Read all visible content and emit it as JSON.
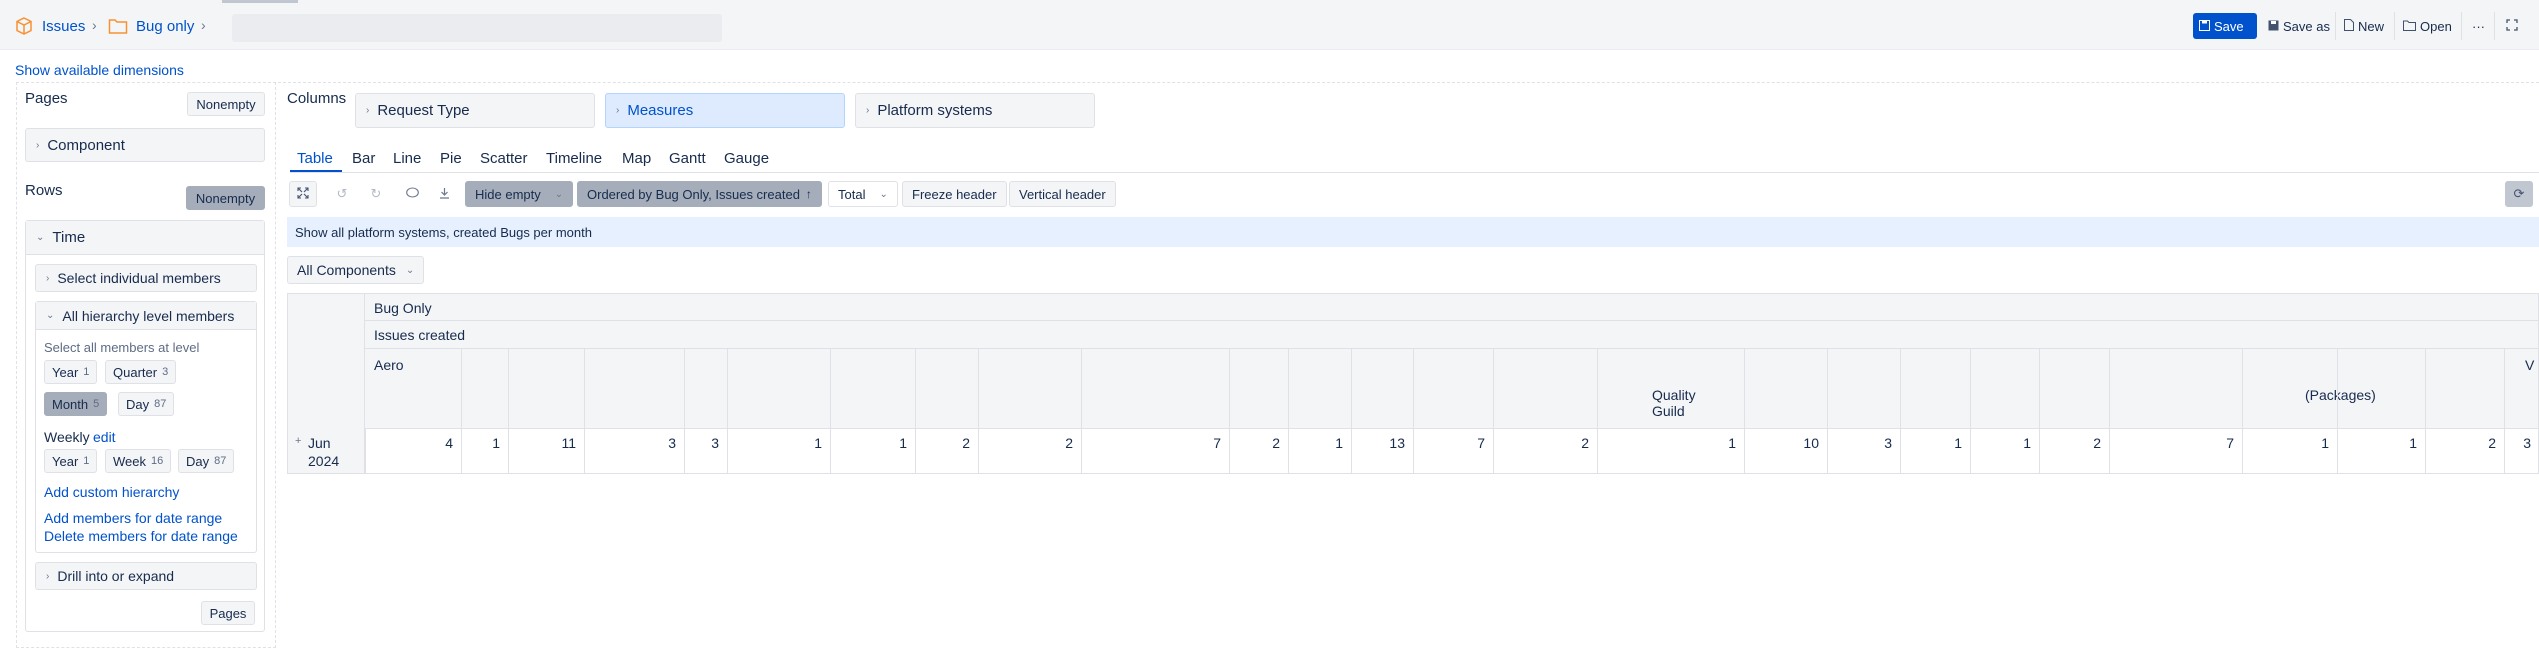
{
  "breadcrumb": {
    "issues": "Issues",
    "report": "Bug only"
  },
  "toolbar": {
    "save": "Save",
    "save_as": "Save as",
    "new": "New",
    "open": "Open",
    "more": "···"
  },
  "show_dimensions": "Show available dimensions",
  "pages": {
    "label": "Pages",
    "nonempty": "Nonempty",
    "dimension": "Component"
  },
  "columns": {
    "label": "Columns",
    "dims": [
      "Request Type",
      "Measures",
      "Platform systems"
    ]
  },
  "rows": {
    "label": "Rows",
    "nonempty": "Nonempty",
    "dimension": "Time",
    "select_individual": "Select individual members",
    "all_hierarchy": "All hierarchy level members",
    "select_all_text": "Select all members at level",
    "levels": [
      {
        "name": "Year",
        "count": "1"
      },
      {
        "name": "Quarter",
        "count": "3"
      },
      {
        "name": "Month",
        "count": "5"
      },
      {
        "name": "Day",
        "count": "87"
      }
    ],
    "weekly_label": "Weekly",
    "weekly_edit": "edit",
    "weekly_levels": [
      {
        "name": "Year",
        "count": "1"
      },
      {
        "name": "Week",
        "count": "16"
      },
      {
        "name": "Day",
        "count": "87"
      }
    ],
    "add_custom": "Add custom hierarchy",
    "add_members": "Add members for date range",
    "delete_members": "Delete members for date range",
    "drill": "Drill into or expand",
    "pages_btn": "Pages"
  },
  "tabs": [
    "Table",
    "Bar",
    "Line",
    "Pie",
    "Scatter",
    "Timeline",
    "Map",
    "Gantt",
    "Gauge"
  ],
  "report_toolbar": {
    "hide_empty": "Hide empty",
    "ordered": "Ordered by Bug Only, Issues created",
    "total": "Total",
    "freeze": "Freeze header",
    "vertical": "Vertical header"
  },
  "description": "Show all platform systems, created Bugs per month",
  "components_select": "All Components",
  "table": {
    "header1": "Bug Only",
    "header2": "Issues created",
    "header3_first": "Aero",
    "header3_quality": "Quality Guild",
    "header3_packages": "(Packages)",
    "header3_last": "V",
    "row_label": "Jun 2024",
    "values": [
      "4",
      "1",
      "11",
      "3",
      "3",
      "1",
      "1",
      "2",
      "2",
      "7",
      "2",
      "1",
      "13",
      "7",
      "2",
      "1",
      "10",
      "3",
      "1",
      "1",
      "2",
      "7",
      "1",
      "1",
      "2",
      "3"
    ]
  }
}
